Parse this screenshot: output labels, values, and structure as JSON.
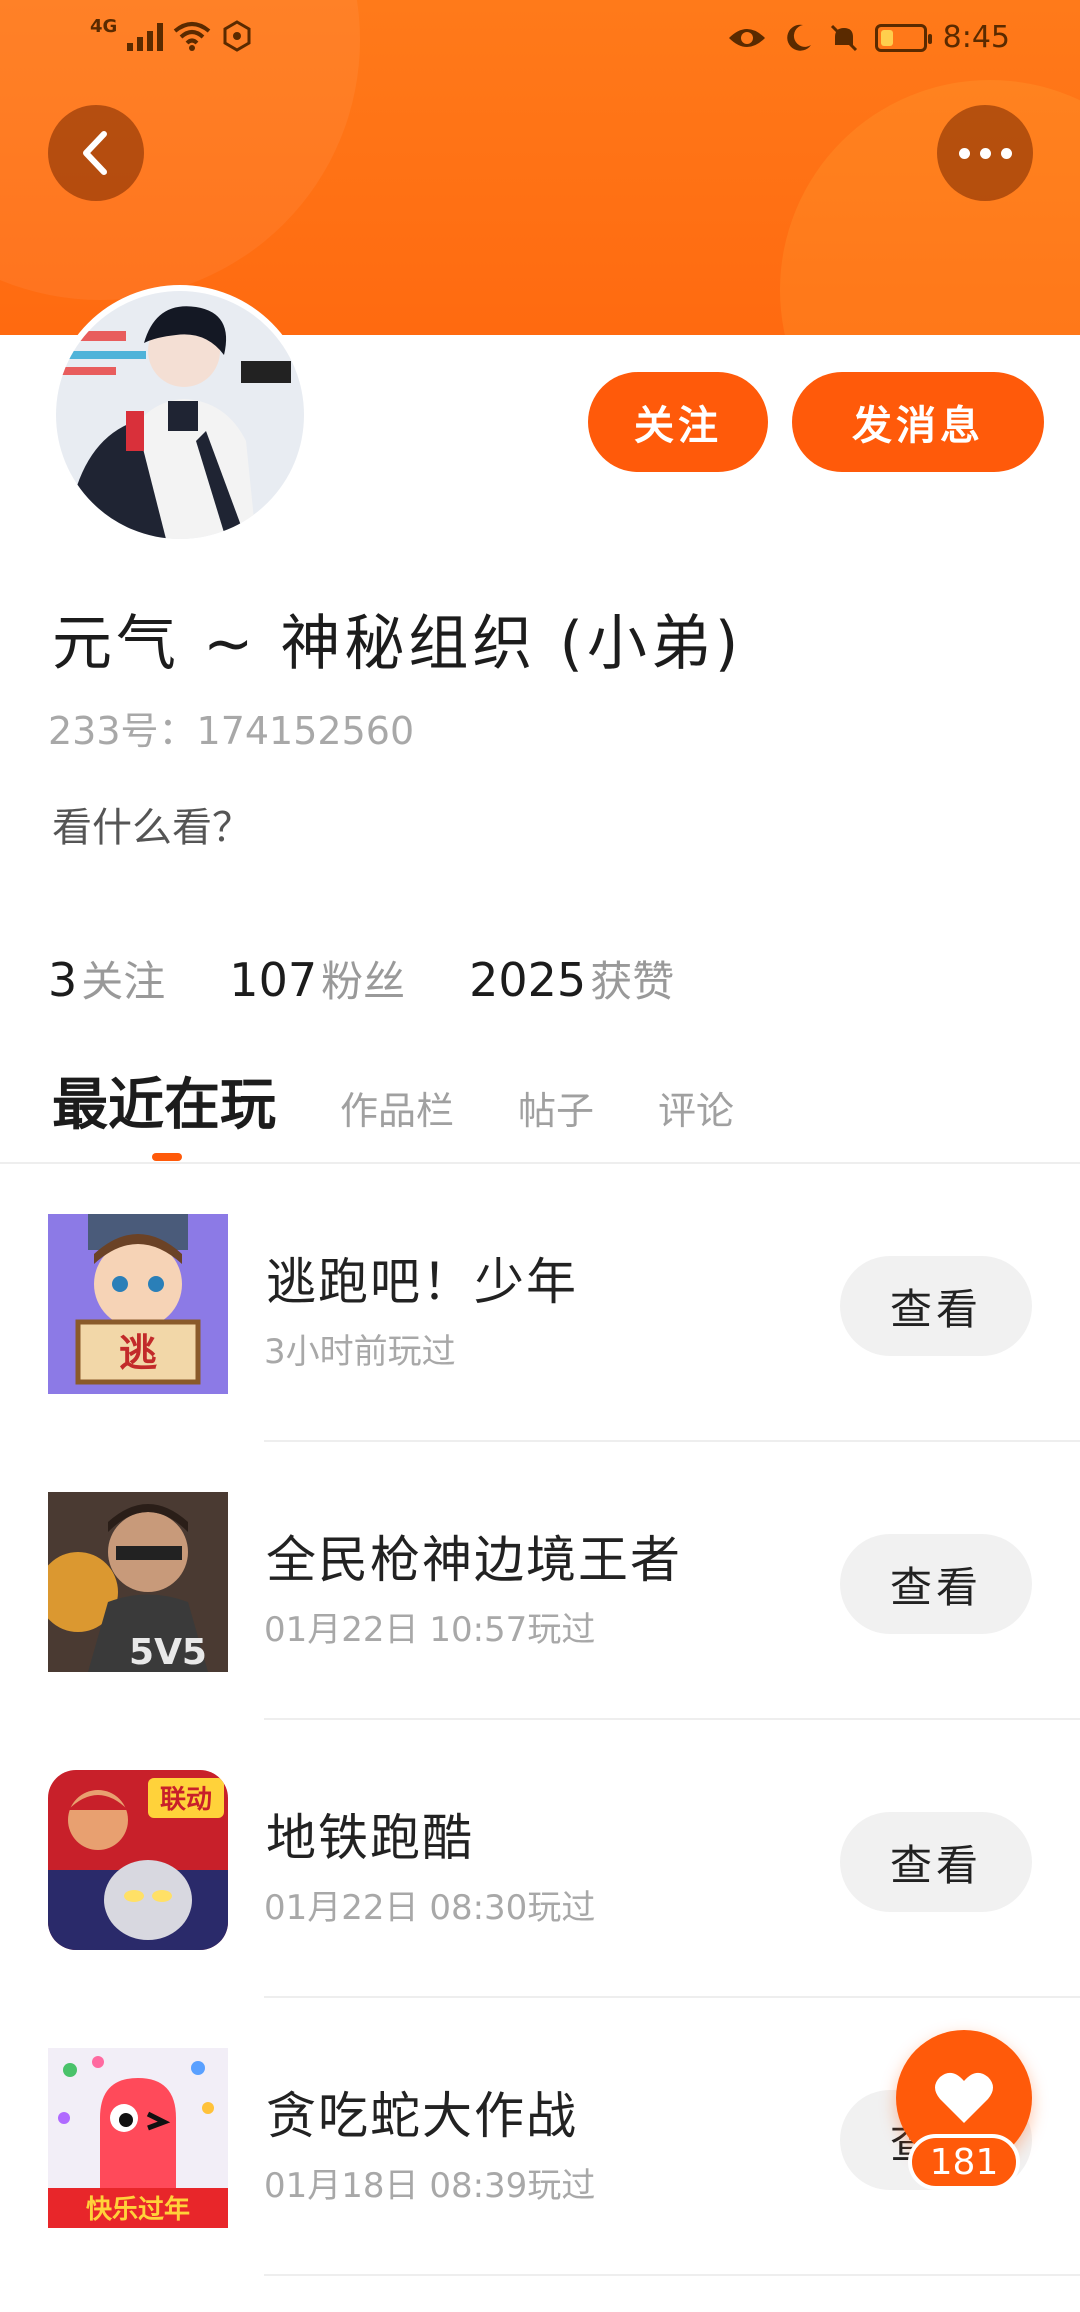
{
  "status_bar": {
    "network": "4G",
    "time": "8:45",
    "battery_level": 0.3
  },
  "header": {
    "back_icon": "chevron-left-icon",
    "more_icon": "more-dots-icon"
  },
  "profile": {
    "follow_label": "关注",
    "message_label": "发消息",
    "nickname": "元气 ~ 神秘组织 (小弟)",
    "id_text": "233号：174152560",
    "bio": "看什么看？"
  },
  "stats": [
    {
      "num": "3",
      "label": "关注"
    },
    {
      "num": "107",
      "label": "粉丝"
    },
    {
      "num": "2025",
      "label": "获赞"
    }
  ],
  "tabs": [
    {
      "label": "最近在玩"
    },
    {
      "label": "作品栏"
    },
    {
      "label": "帖子"
    },
    {
      "label": "评论"
    }
  ],
  "games": [
    {
      "title": "逃跑吧！少年",
      "time": "3小时前玩过",
      "button": "查看",
      "icon_text": "逃",
      "icon_color": "#7b6bd6"
    },
    {
      "title": "全民枪神边境王者",
      "time": "01月22日 10:57玩过",
      "button": "查看",
      "icon_text": "5V5",
      "icon_color": "#5a3a2a"
    },
    {
      "title": "地铁跑酷",
      "time": "01月22日 08:30玩过",
      "button": "查看",
      "icon_text": "联动",
      "icon_color": "#d8262f"
    },
    {
      "title": "贪吃蛇大作战",
      "time": "01月18日 08:39玩过",
      "button": "查看",
      "icon_text": "快乐过年",
      "icon_color": "#ff4a4a"
    }
  ],
  "likes": {
    "count": "181",
    "icon": "heart-icon"
  },
  "colors": {
    "accent": "#ff5a0a",
    "header": "#ff7a1a"
  }
}
